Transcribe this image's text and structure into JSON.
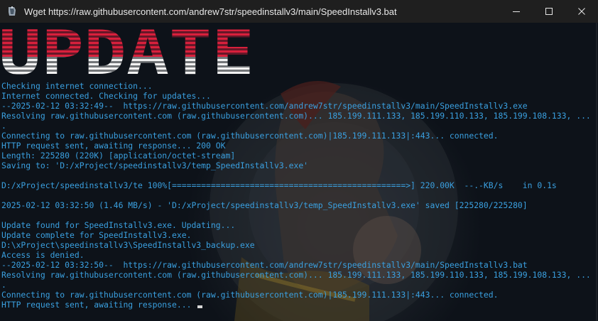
{
  "window": {
    "title": "Wget https://raw.githubusercontent.com/andrew7str/speedinstallv3/main/SpeedInstallv3.bat",
    "controls": [
      "minimize",
      "maximize",
      "close"
    ]
  },
  "banner": {
    "text": "UPDATE",
    "colors": {
      "top": "#d8203c",
      "bottom": "#f2f2f2",
      "stripe": "#0c1118"
    }
  },
  "terminal": {
    "text_color": "#3aa0e0",
    "lines": [
      "Checking internet connection...",
      "Internet connected. Checking for updates...",
      "--2025-02-12 03:32:49--  https://raw.githubusercontent.com/andrew7str/speedinstallv3/main/SpeedInstallv3.exe",
      "Resolving raw.githubusercontent.com (raw.githubusercontent.com)... 185.199.111.133, 185.199.110.133, 185.199.108.133, ...",
      ".",
      "Connecting to raw.githubusercontent.com (raw.githubusercontent.com)|185.199.111.133|:443... connected.",
      "HTTP request sent, awaiting response... 200 OK",
      "Length: 225280 (220K) [application/octet-stream]",
      "Saving to: 'D:/xProject/speedinstallv3/temp_SpeedInstallv3.exe'",
      "",
      "D:/xProject/speedinstallv3/te 100%[================================================>] 220.00K  --.-KB/s    in 0.1s",
      "",
      "2025-02-12 03:32:50 (1.46 MB/s) - 'D:/xProject/speedinstallv3/temp_SpeedInstallv3.exe' saved [225280/225280]",
      "",
      "Update found for SpeedInstallv3.exe. Updating...",
      "Update complete for SpeedInstallv3.exe.",
      "D:\\xProject\\speedinstallv3\\SpeedInstallv3_backup.exe",
      "Access is denied.",
      "--2025-02-12 03:32:50--  https://raw.githubusercontent.com/andrew7str/speedinstallv3/main/SpeedInstallv3.bat",
      "Resolving raw.githubusercontent.com (raw.githubusercontent.com)... 185.199.111.133, 185.199.110.133, 185.199.108.133, ...",
      ".",
      "Connecting to raw.githubusercontent.com (raw.githubusercontent.com)|185.199.111.133|:443... connected.",
      "HTTP request sent, awaiting response... "
    ]
  }
}
